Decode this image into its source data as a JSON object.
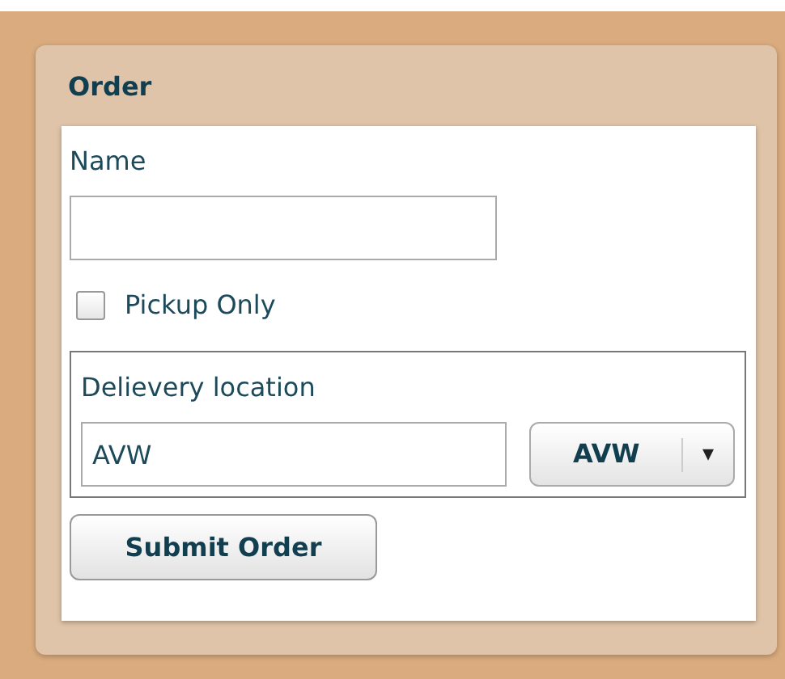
{
  "panel": {
    "title": "Order"
  },
  "name_field": {
    "label": "Name"
  },
  "pickup_only": {
    "label": "Pickup Only",
    "checked": false
  },
  "delivery": {
    "legend": "Delievery location",
    "value": "AVW",
    "select": {
      "value": "AVW",
      "caret": "▾"
    }
  },
  "submit_button": "Submit Order"
}
